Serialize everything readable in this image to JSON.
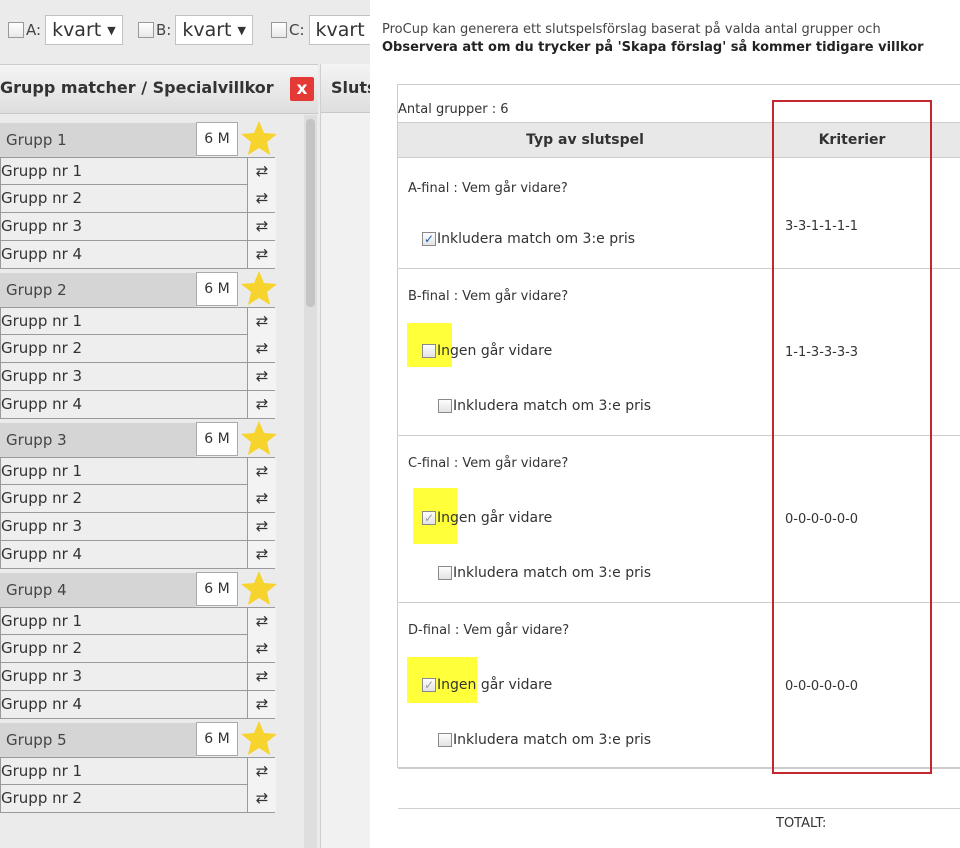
{
  "toolbar": {
    "groups": [
      {
        "letter": "A:",
        "value": "kvart"
      },
      {
        "letter": "B:",
        "value": "kvart"
      },
      {
        "letter": "C:",
        "value": "kvart"
      }
    ]
  },
  "left_panel": {
    "title": "Grupp matcher / Specialvillkor",
    "close_label": "x",
    "groups": [
      {
        "name": "Grupp 1",
        "matches": "6 M",
        "rows": [
          "Grupp nr 1",
          "Grupp nr 2",
          "Grupp nr 3",
          "Grupp nr 4"
        ]
      },
      {
        "name": "Grupp 2",
        "matches": "6 M",
        "rows": [
          "Grupp nr 1",
          "Grupp nr 2",
          "Grupp nr 3",
          "Grupp nr 4"
        ]
      },
      {
        "name": "Grupp 3",
        "matches": "6 M",
        "rows": [
          "Grupp nr 1",
          "Grupp nr 2",
          "Grupp nr 3",
          "Grupp nr 4"
        ]
      },
      {
        "name": "Grupp 4",
        "matches": "6 M",
        "rows": [
          "Grupp nr 1",
          "Grupp nr 2",
          "Grupp nr 3",
          "Grupp nr 4"
        ]
      },
      {
        "name": "Grupp 5",
        "matches": "6 M",
        "rows": [
          "Grupp nr 1",
          "Grupp nr 2"
        ]
      }
    ],
    "swap_icon": "⇄"
  },
  "tab_strip": {
    "label": "Slutspel"
  },
  "content": {
    "info_line": "ProCup kan generera ett slutspelsförslag baserat på valda antal grupper och",
    "warning_line": "Observera att om du trycker på 'Skapa förslag' så kommer tidigare villkor",
    "antal": "Antal grupper : 6",
    "headers": {
      "typ": "Typ av slutspel",
      "kriterier": "Kriterier"
    },
    "finals": [
      {
        "title": "A-final : Vem går vidare?",
        "criteria": "3-3-1-1-1-1",
        "include_checked": true,
        "include_label": "Inkludera match om 3:e pris"
      },
      {
        "title": "B-final : Vem går vidare?",
        "criteria": "1-1-3-3-3-3",
        "none_checked": false,
        "none_label": "Ingen går vidare",
        "include_checked": false,
        "include_label": "Inkludera match om 3:e pris"
      },
      {
        "title": "C-final : Vem går vidare?",
        "criteria": "0-0-0-0-0-0",
        "none_checked": true,
        "none_label": "Ingen går vidare",
        "include_checked": false,
        "include_label": "Inkludera match om 3:e pris"
      },
      {
        "title": "D-final : Vem går vidare?",
        "criteria": "0-0-0-0-0-0",
        "none_checked": true,
        "none_label": "Ingen går vidare",
        "include_checked": false,
        "include_label": "Inkludera match om 3:e pris"
      }
    ],
    "total_label": "TOTALT:"
  },
  "colors": {
    "highlight": "#ffff3a",
    "annotation_box": "#c1272d",
    "close_button": "#e53935",
    "star": "#f6d32d"
  }
}
